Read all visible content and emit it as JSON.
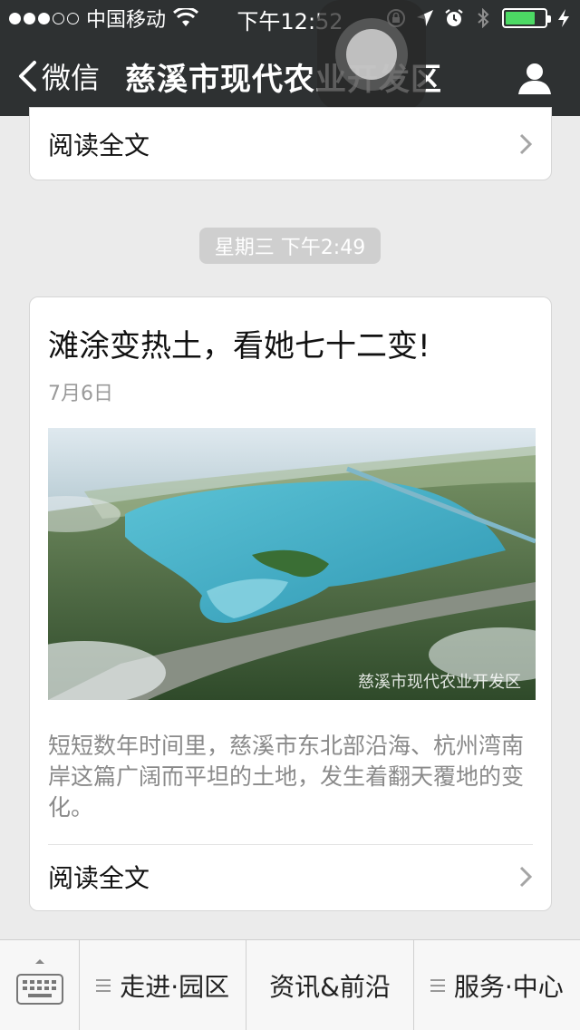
{
  "status_bar": {
    "carrier": "中国移动",
    "time": "下午12:52",
    "signal_dots_filled": 3,
    "signal_dots_total": 5,
    "battery_level": 0.75,
    "battery_color": "#4cd964"
  },
  "nav": {
    "back_label": "微信",
    "title": "慈溪市现代农业开发区",
    "profile_icon": "person-icon"
  },
  "messages": {
    "first_card": {
      "read_more_label": "阅读全文"
    },
    "timestamp": "星期三 下午2:49",
    "article": {
      "title": "滩涂变热土，看她七十二变!",
      "date": "7月6日",
      "image_watermark": "慈溪市现代农业开发区",
      "summary": "短短数年时间里，慈溪市东北部沿海、杭州湾南岸这篇广阔而平坦的土地，发生着翻天覆地的变化。",
      "read_more_label": "阅读全文"
    }
  },
  "menu": {
    "keyboard_icon": "keyboard-icon",
    "items": [
      {
        "label": "走进·园区"
      },
      {
        "label": "资讯&前沿"
      },
      {
        "label": "服务·中心"
      }
    ]
  }
}
